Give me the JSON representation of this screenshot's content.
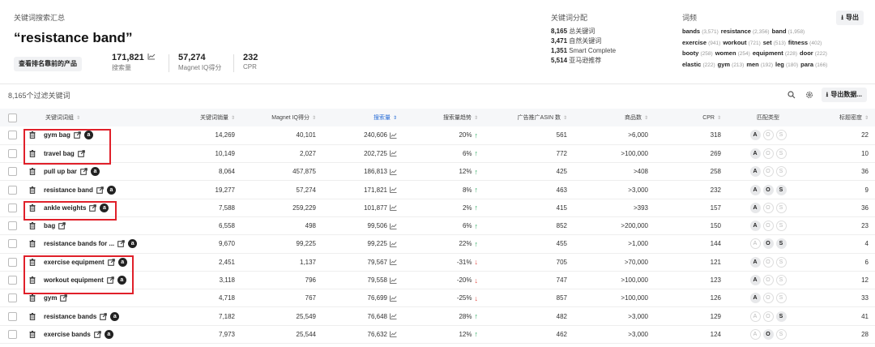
{
  "summary": {
    "title": "关键词搜索汇总",
    "keyword": "“resistance band”",
    "view_top_button": "查看排名靠前的产品",
    "metrics": [
      {
        "value": "171,821",
        "label": "搜索量"
      },
      {
        "value": "57,274",
        "label": "Magnet IQ得分"
      },
      {
        "value": "232",
        "label": "CPR"
      }
    ]
  },
  "distribution": {
    "title": "关键词分配",
    "rows": [
      {
        "value": "8,165",
        "label": "总关键词"
      },
      {
        "value": "3,471",
        "label": "自然关键词"
      },
      {
        "value": "1,351",
        "label": "Smart Complete"
      },
      {
        "value": "5,514",
        "label": "亚马逊推荐"
      }
    ]
  },
  "frequency": {
    "title": "词频",
    "export_label": "导出",
    "lines": [
      [
        {
          "w": "bands",
          "c": "(3,571)"
        },
        {
          "w": "resistance",
          "c": "(2,356)"
        },
        {
          "w": "band",
          "c": "(1,958)"
        }
      ],
      [
        {
          "w": "exercise",
          "c": "(941)"
        },
        {
          "w": "workout",
          "c": "(721)"
        },
        {
          "w": "set",
          "c": "(513)"
        },
        {
          "w": "fitness",
          "c": "(402)"
        }
      ],
      [
        {
          "w": "booty",
          "c": "(258)"
        },
        {
          "w": "women",
          "c": "(254)"
        },
        {
          "w": "equipment",
          "c": "(228)"
        },
        {
          "w": "door",
          "c": "(222)"
        }
      ],
      [
        {
          "w": "elastic",
          "c": "(222)"
        },
        {
          "w": "gym",
          "c": "(213)"
        },
        {
          "w": "men",
          "c": "(192)"
        },
        {
          "w": "leg",
          "c": "(180)"
        },
        {
          "w": "para",
          "c": "(166)"
        }
      ]
    ]
  },
  "table_header": {
    "filter_count": "8,165个过滤关键词",
    "export_data": "导出数据...",
    "columns": [
      "关键词词组",
      "关键词销量",
      "Magnet IQ得分",
      "搜索量",
      "搜索量趋势",
      "广告推广ASIN 数",
      "商品数",
      "CPR",
      "匹配类型",
      "标题密度"
    ]
  },
  "rows": [
    {
      "keyword": "gym bag",
      "amazon": true,
      "sales": "14,269",
      "miq": "40,101",
      "sv": "240,606",
      "trend": "20%",
      "dir": "up",
      "asin": "561",
      "products": ">6,000",
      "cpr": "318",
      "match": [
        true,
        false,
        false
      ],
      "density": "22"
    },
    {
      "keyword": "travel bag",
      "amazon": false,
      "sales": "10,149",
      "miq": "2,027",
      "sv": "202,725",
      "trend": "6%",
      "dir": "up",
      "asin": "772",
      "products": ">100,000",
      "cpr": "269",
      "match": [
        true,
        false,
        false
      ],
      "density": "10"
    },
    {
      "keyword": "pull up bar",
      "amazon": true,
      "sales": "8,064",
      "miq": "457,875",
      "sv": "186,813",
      "trend": "12%",
      "dir": "up",
      "asin": "425",
      "products": ">408",
      "cpr": "258",
      "match": [
        true,
        false,
        false
      ],
      "density": "36"
    },
    {
      "keyword": "resistance band",
      "amazon": true,
      "sales": "19,277",
      "miq": "57,274",
      "sv": "171,821",
      "trend": "8%",
      "dir": "up",
      "asin": "463",
      "products": ">3,000",
      "cpr": "232",
      "match": [
        true,
        true,
        true
      ],
      "density": "9"
    },
    {
      "keyword": "ankle weights",
      "amazon": true,
      "sales": "7,588",
      "miq": "259,229",
      "sv": "101,877",
      "trend": "2%",
      "dir": "up",
      "asin": "415",
      "products": ">393",
      "cpr": "157",
      "match": [
        true,
        false,
        false
      ],
      "density": "36"
    },
    {
      "keyword": "bag",
      "amazon": false,
      "sales": "6,558",
      "miq": "498",
      "sv": "99,506",
      "trend": "6%",
      "dir": "up",
      "asin": "852",
      "products": ">200,000",
      "cpr": "150",
      "match": [
        true,
        false,
        false
      ],
      "density": "23"
    },
    {
      "keyword": "resistance bands for ...",
      "amazon": true,
      "sales": "9,670",
      "miq": "99,225",
      "sv": "99,225",
      "trend": "22%",
      "dir": "up",
      "asin": "455",
      "products": ">1,000",
      "cpr": "144",
      "match": [
        false,
        true,
        true
      ],
      "density": "4"
    },
    {
      "keyword": "exercise equipment",
      "amazon": true,
      "sales": "2,451",
      "miq": "1,137",
      "sv": "79,567",
      "trend": "-31%",
      "dir": "down",
      "asin": "705",
      "products": ">70,000",
      "cpr": "121",
      "match": [
        true,
        false,
        false
      ],
      "density": "6"
    },
    {
      "keyword": "workout equipment",
      "amazon": true,
      "sales": "3,118",
      "miq": "796",
      "sv": "79,558",
      "trend": "-20%",
      "dir": "down",
      "asin": "747",
      "products": ">100,000",
      "cpr": "123",
      "match": [
        true,
        false,
        false
      ],
      "density": "12"
    },
    {
      "keyword": "gym",
      "amazon": false,
      "sales": "4,718",
      "miq": "767",
      "sv": "76,699",
      "trend": "-25%",
      "dir": "down",
      "asin": "857",
      "products": ">100,000",
      "cpr": "126",
      "match": [
        true,
        false,
        false
      ],
      "density": "33"
    },
    {
      "keyword": "resistance bands",
      "amazon": true,
      "sales": "7,182",
      "miq": "25,549",
      "sv": "76,648",
      "trend": "28%",
      "dir": "up",
      "asin": "482",
      "products": ">3,000",
      "cpr": "129",
      "match": [
        false,
        false,
        true
      ],
      "density": "41"
    },
    {
      "keyword": "exercise bands",
      "amazon": true,
      "sales": "7,973",
      "miq": "25,544",
      "sv": "76,632",
      "trend": "12%",
      "dir": "up",
      "asin": "462",
      "products": ">3,000",
      "cpr": "124",
      "match": [
        false,
        true,
        false
      ],
      "density": "28"
    }
  ],
  "match_letters": [
    "A",
    "O",
    "S"
  ],
  "colors": {
    "highlight_box": "#e0202a",
    "trend_up": "#26a65b",
    "trend_down": "#e2463d",
    "link_blue": "#2b6fd6"
  }
}
